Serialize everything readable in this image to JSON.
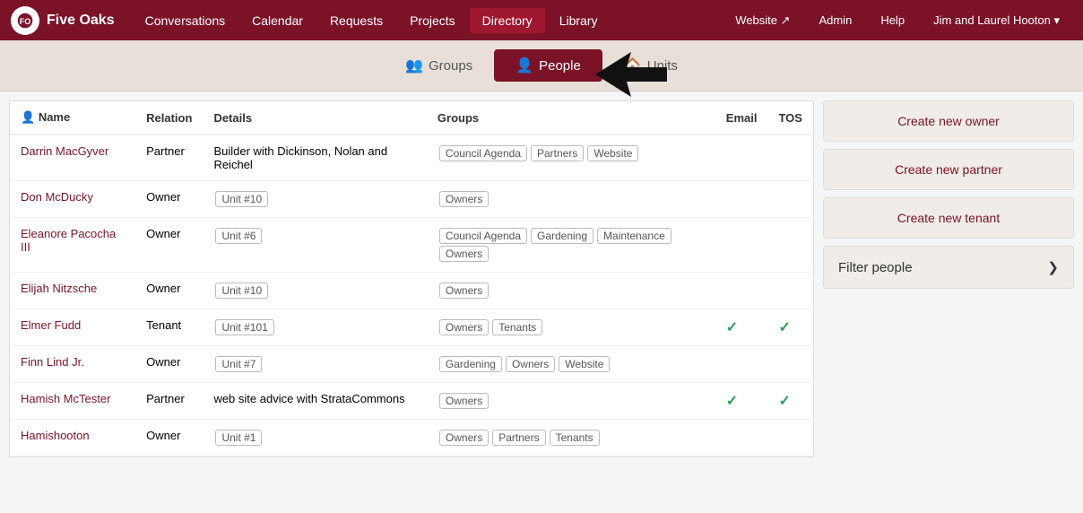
{
  "app": {
    "logo_text": "Five Oaks",
    "logo_initial": "FO"
  },
  "top_nav": {
    "items": [
      {
        "label": "Conversations",
        "active": false
      },
      {
        "label": "Calendar",
        "active": false
      },
      {
        "label": "Requests",
        "active": false
      },
      {
        "label": "Projects",
        "active": false
      },
      {
        "label": "Directory",
        "active": true
      },
      {
        "label": "Library",
        "active": false
      }
    ],
    "right_items": [
      {
        "label": "Website ↗",
        "active": false
      },
      {
        "label": "Admin",
        "active": false
      },
      {
        "label": "Help",
        "active": false
      },
      {
        "label": "Jim and Laurel Hooton ▾",
        "active": false
      }
    ]
  },
  "sub_nav": {
    "tabs": [
      {
        "label": "Groups",
        "icon": "👥",
        "active": false
      },
      {
        "label": "People",
        "icon": "👤",
        "active": true
      },
      {
        "label": "Units",
        "icon": "🏠",
        "active": false
      }
    ]
  },
  "table": {
    "columns": [
      {
        "label": "Name"
      },
      {
        "label": "Relation"
      },
      {
        "label": "Details"
      },
      {
        "label": "Groups"
      },
      {
        "label": "Email"
      },
      {
        "label": "TOS"
      }
    ],
    "rows": [
      {
        "name": "Darrin MacGyver",
        "relation": "Partner",
        "details": "Builder with Dickinson, Nolan and Reichel",
        "groups": [
          "Council Agenda",
          "Partners",
          "Website"
        ],
        "email": false,
        "tos": false
      },
      {
        "name": "Don McDucky",
        "relation": "Owner",
        "details": "Unit #10",
        "groups": [
          "Owners"
        ],
        "email": false,
        "tos": false
      },
      {
        "name": "Eleanore Pacocha III",
        "relation": "Owner",
        "details": "Unit #6",
        "groups": [
          "Council Agenda",
          "Gardening",
          "Maintenance",
          "Owners"
        ],
        "email": false,
        "tos": false
      },
      {
        "name": "Elijah Nitzsche",
        "relation": "Owner",
        "details": "Unit #10",
        "groups": [
          "Owners"
        ],
        "email": false,
        "tos": false
      },
      {
        "name": "Elmer Fudd",
        "relation": "Tenant",
        "details": "Unit #101",
        "groups": [
          "Owners",
          "Tenants"
        ],
        "email": true,
        "tos": true
      },
      {
        "name": "Finn Lind Jr.",
        "relation": "Owner",
        "details": "Unit #7",
        "groups": [
          "Gardening",
          "Owners",
          "Website"
        ],
        "email": false,
        "tos": false
      },
      {
        "name": "Hamish McTester",
        "relation": "Partner",
        "details": "web site advice with StrataCommons",
        "groups": [
          "Owners"
        ],
        "email": true,
        "tos": true
      },
      {
        "name": "Hamishooton",
        "relation": "Owner",
        "details": "Unit #1",
        "groups": [
          "Owners",
          "Partners",
          "Tenants"
        ],
        "email": false,
        "tos": false
      }
    ]
  },
  "sidebar": {
    "create_owner": "Create new owner",
    "create_partner": "Create new partner",
    "create_tenant": "Create new tenant",
    "filter_label": "Filter people",
    "filter_chevron": "❯"
  }
}
